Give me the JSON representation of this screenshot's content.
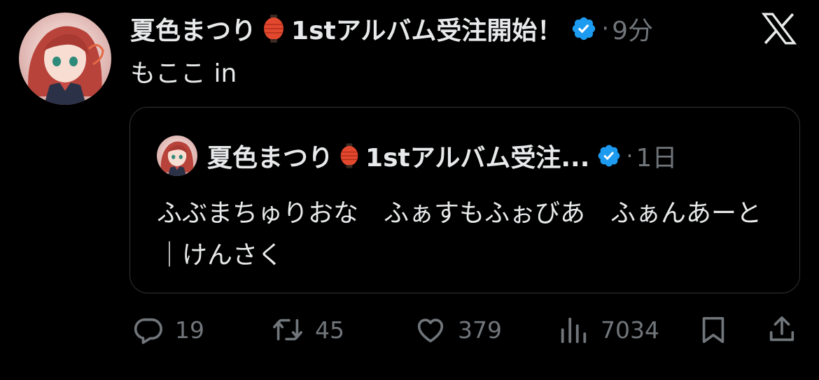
{
  "tweet": {
    "author": {
      "display_name": "夏色まつり",
      "name_suffix": "1stアルバム受注開始！",
      "verified_color": "#1d9bf0",
      "avatar_icon": "anime-girl-avatar"
    },
    "dot": "·",
    "time": "9分",
    "text": "もここ in",
    "app_logo": "x-logo-icon"
  },
  "quote": {
    "display_name": "夏色まつり",
    "name_suffix": "1stアルバム受注...",
    "dot": "·",
    "time": "1日",
    "text": "ふぶまちゅりおな　ふぁすもふぉびあ　ふぁんあーと　｜けんさく"
  },
  "actions": {
    "reply": {
      "icon": "reply-icon",
      "count": "19"
    },
    "retweet": {
      "icon": "retweet-icon",
      "count": "45"
    },
    "like": {
      "icon": "heart-icon",
      "count": "379"
    },
    "views": {
      "icon": "views-icon",
      "count": "7034"
    },
    "bookmark": {
      "icon": "bookmark-icon"
    },
    "share": {
      "icon": "share-icon"
    }
  },
  "colors": {
    "background": "#000000",
    "text": "#e7e9ea",
    "secondary": "#71767b",
    "border": "#2f3336",
    "verified": "#1d9bf0"
  }
}
